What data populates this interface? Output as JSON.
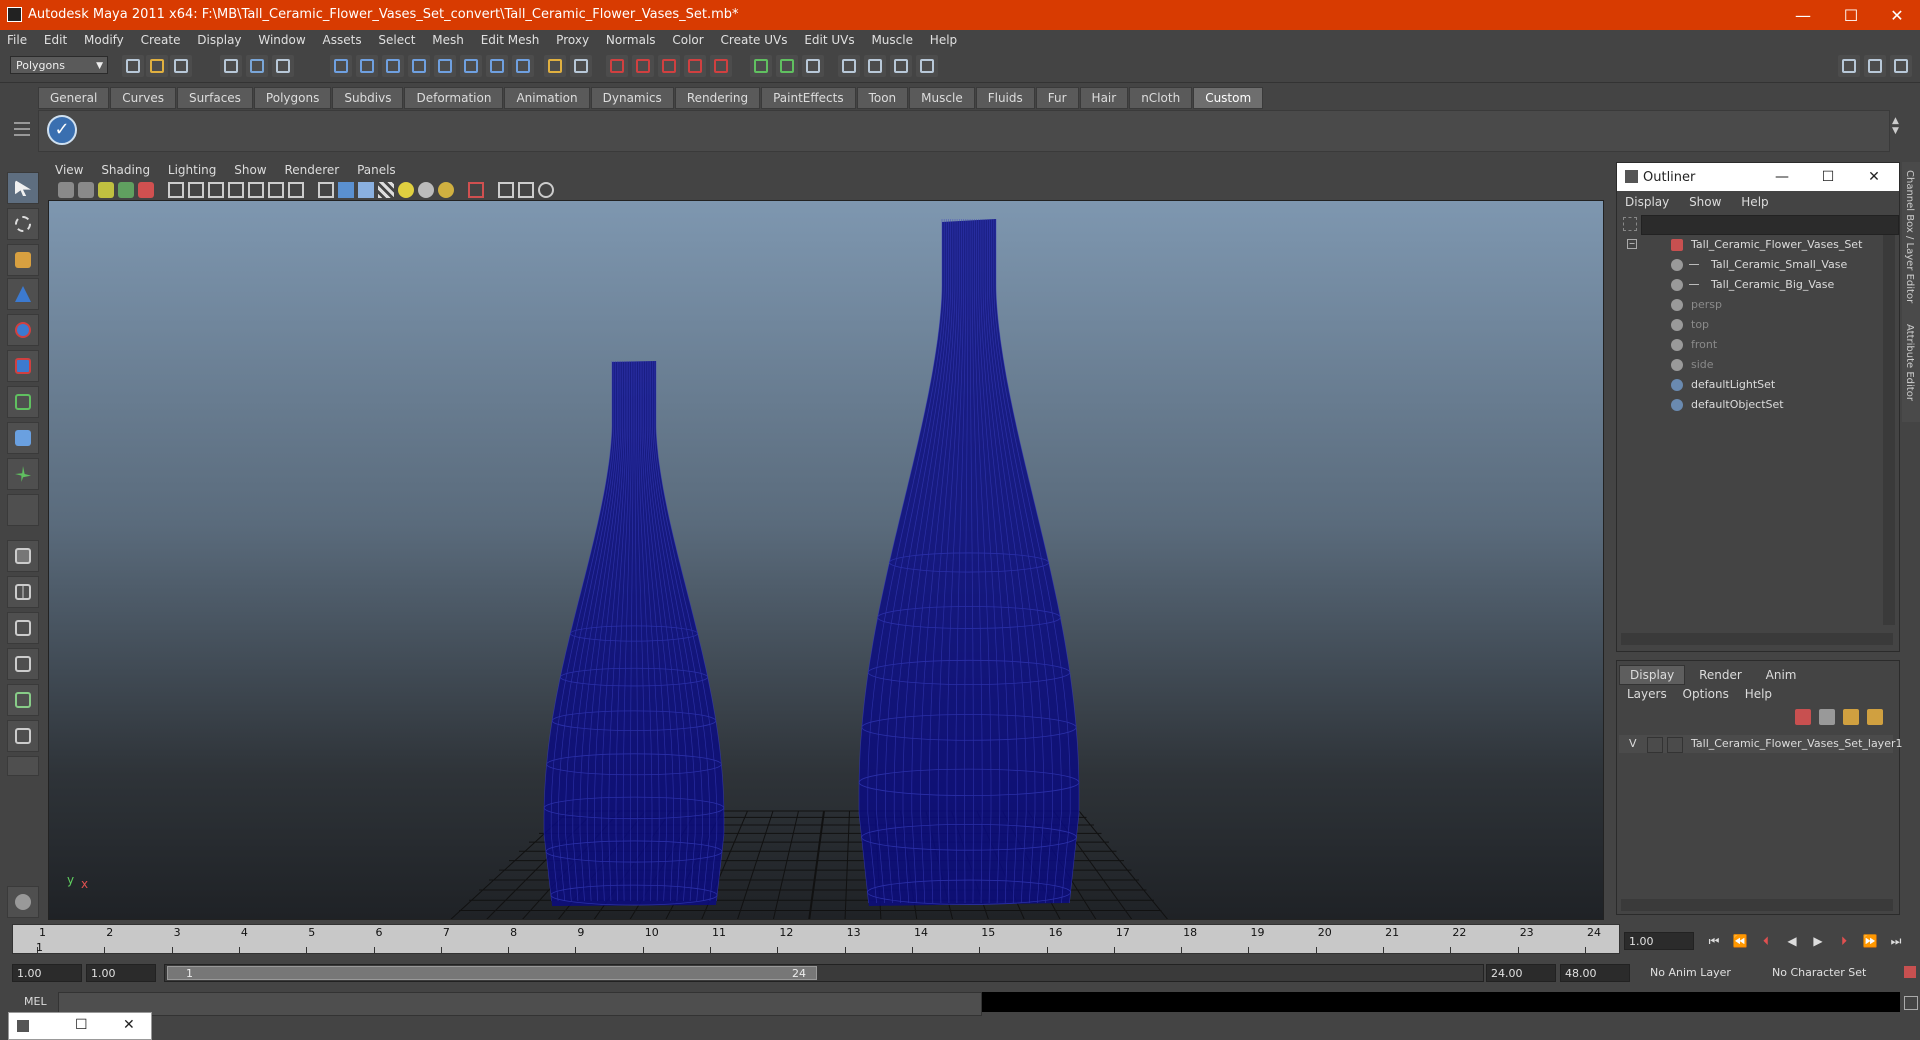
{
  "window": {
    "title": "Autodesk Maya 2011 x64: F:\\MB\\Tall_Ceramic_Flower_Vases_Set_convert\\Tall_Ceramic_Flower_Vases_Set.mb*",
    "minimize": "—",
    "maximize": "☐",
    "close": "✕"
  },
  "menubar": [
    "File",
    "Edit",
    "Modify",
    "Create",
    "Display",
    "Window",
    "Assets",
    "Select",
    "Mesh",
    "Edit Mesh",
    "Proxy",
    "Normals",
    "Color",
    "Create UVs",
    "Edit UVs",
    "Muscle",
    "Help"
  ],
  "statusline": {
    "mode": "Polygons"
  },
  "shelf": {
    "tabs": [
      "General",
      "Curves",
      "Surfaces",
      "Polygons",
      "Subdivs",
      "Deformation",
      "Animation",
      "Dynamics",
      "Rendering",
      "PaintEffects",
      "Toon",
      "Muscle",
      "Fluids",
      "Fur",
      "Hair",
      "nCloth",
      "Custom"
    ],
    "active_tab": "Custom"
  },
  "viewport": {
    "menu": [
      "View",
      "Shading",
      "Lighting",
      "Show",
      "Renderer",
      "Panels"
    ],
    "axis_y": "y",
    "axis_x": "x",
    "mesh_color": "#0b0c80",
    "grid_color": "#111111"
  },
  "outliner": {
    "title": "Outliner",
    "menu": [
      "Display",
      "Show",
      "Help"
    ],
    "items": [
      {
        "label": "Tall_Ceramic_Flower_Vases_Set",
        "indent": 0,
        "dim": false
      },
      {
        "label": "Tall_Ceramic_Small_Vase",
        "indent": 1,
        "dim": false
      },
      {
        "label": "Tall_Ceramic_Big_Vase",
        "indent": 1,
        "dim": false
      },
      {
        "label": "persp",
        "indent": 0,
        "dim": true
      },
      {
        "label": "top",
        "indent": 0,
        "dim": true
      },
      {
        "label": "front",
        "indent": 0,
        "dim": true
      },
      {
        "label": "side",
        "indent": 0,
        "dim": true
      },
      {
        "label": "defaultLightSet",
        "indent": 0,
        "dim": false
      },
      {
        "label": "defaultObjectSet",
        "indent": 0,
        "dim": false
      }
    ]
  },
  "sidetabs": [
    "Channel Box / Layer Editor",
    "Attribute Editor"
  ],
  "layer_editor": {
    "tabs": [
      "Display",
      "Render",
      "Anim"
    ],
    "active_tab": "Display",
    "menu": [
      "Layers",
      "Options",
      "Help"
    ],
    "layer": {
      "visible": "V",
      "name": "Tall_Ceramic_Flower_Vases_Set_layer1"
    }
  },
  "timeline": {
    "ticks": [
      "1",
      "2",
      "3",
      "4",
      "5",
      "6",
      "7",
      "8",
      "9",
      "10",
      "11",
      "12",
      "13",
      "14",
      "15",
      "16",
      "17",
      "18",
      "19",
      "20",
      "21",
      "22",
      "23",
      "24"
    ],
    "current_frame_label": "1",
    "current_time_field": "1.00"
  },
  "range": {
    "start_time": "1.00",
    "playback_start": "1.00",
    "range_start_label": "1",
    "range_end_label": "24",
    "playback_end": "24.00",
    "end_time": "48.00",
    "anim_layer": "No Anim Layer",
    "character_set": "No Character Set"
  },
  "cmdline": {
    "label": "MEL"
  }
}
